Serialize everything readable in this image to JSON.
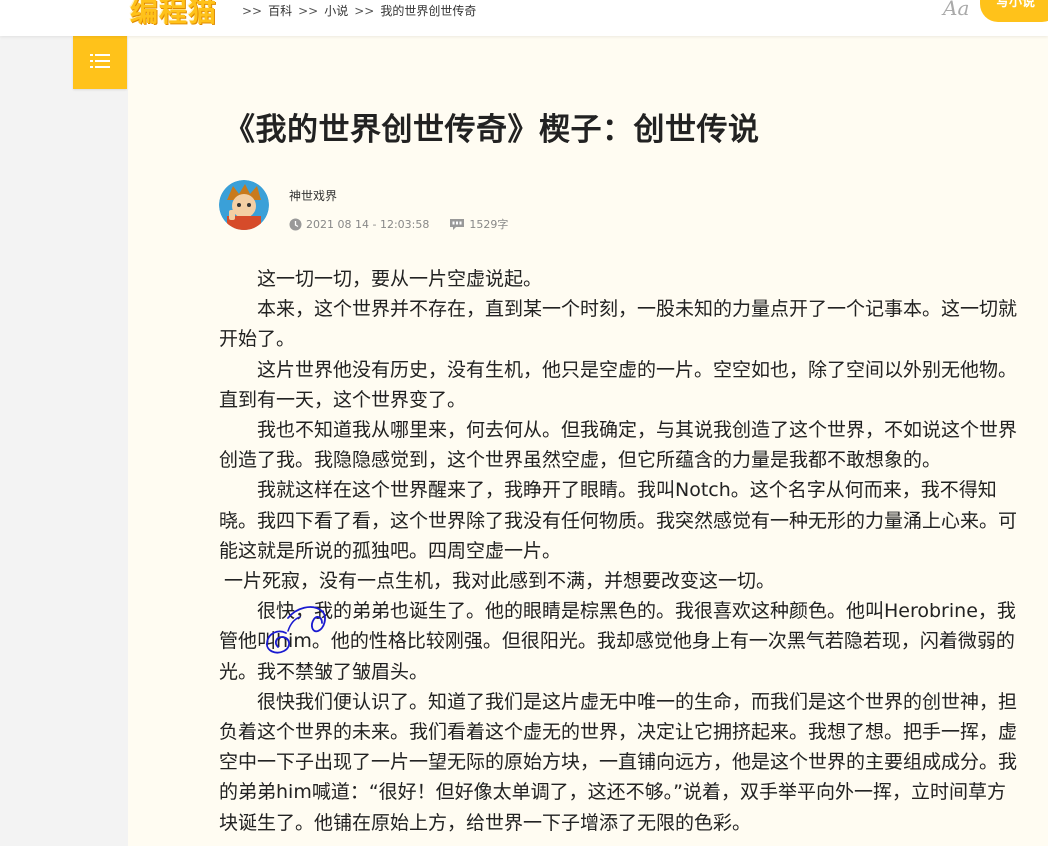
{
  "header": {
    "logo_text": "编程猫",
    "breadcrumb": {
      "sep": ">>",
      "items": [
        "百科",
        "小说",
        "我的世界创世传奇"
      ]
    },
    "font_toggle": "Aa",
    "write_label": "写小说"
  },
  "article": {
    "title": "《我的世界创世传奇》楔子：创世传说",
    "author": "神世戏界",
    "date": "2021 08 14 - 12:03:58",
    "word_count": "1529字",
    "paragraphs": [
      "这一切一切，要从一片空虚说起。",
      "本来，这个世界并不存在，直到某一个时刻，一股未知的力量点开了一个记事本。这一切就开始了。",
      "这片世界他没有历史，没有生机，他只是空虚的一片。空空如也，除了空间以外别无他物。直到有一天，这个世界变了。",
      "我也不知道我从哪里来，何去何从。但我确定，与其说我创造了这个世界，不如说这个世界创造了我。我隐隐感觉到，这个世界虽然空虚，但它所蕴含的力量是我都不敢想象的。",
      "我就这样在这个世界醒来了，我睁开了眼睛。我叫Notch。这个名字从何而来，我不得知晓。我四下看了看，这个世界除了我没有任何物质。我突然感觉有一种无形的力量涌上心来。可能这就是所说的孤独吧。四周空虚一片。",
      "一片死寂，没有一点生机，我对此感到不满，并想要改变这一切。",
      "很快，我的弟弟也诞生了。他的眼睛是棕黑色的。我很喜欢这种颜色。他叫Herobrine，我管他叫him。他的性格比较刚强。但很阳光。我却感觉他身上有一次黑气若隐若现，闪着微弱的光。我不禁皱了皱眉头。",
      "很快我们便认识了。知道了我们是这片虚无中唯一的生命，而我们是这个世界的创世神，担负着这个世界的未来。我们看着这个虚无的世界，决定让它拥挤起来。我想了想。把手一挥，虚空中一下子出现了一片一望无际的原始方块，一直铺向远方，他是这个世界的主要组成成分。我的弟弟him喊道：“很好！但好像太单调了，这还不够。”说着，双手举平向外一挥，立时间草方块诞生了。他铺在原始上方，给世界一下子增添了无限的色彩。"
    ]
  },
  "colors": {
    "accent": "#ffc21a",
    "panel_bg": "#fffcf2",
    "page_bg": "#f3f3f3",
    "scribble": "#1a1ad0"
  },
  "icons": [
    "menu-icon",
    "clock-icon",
    "word-count-icon",
    "avatar"
  ]
}
